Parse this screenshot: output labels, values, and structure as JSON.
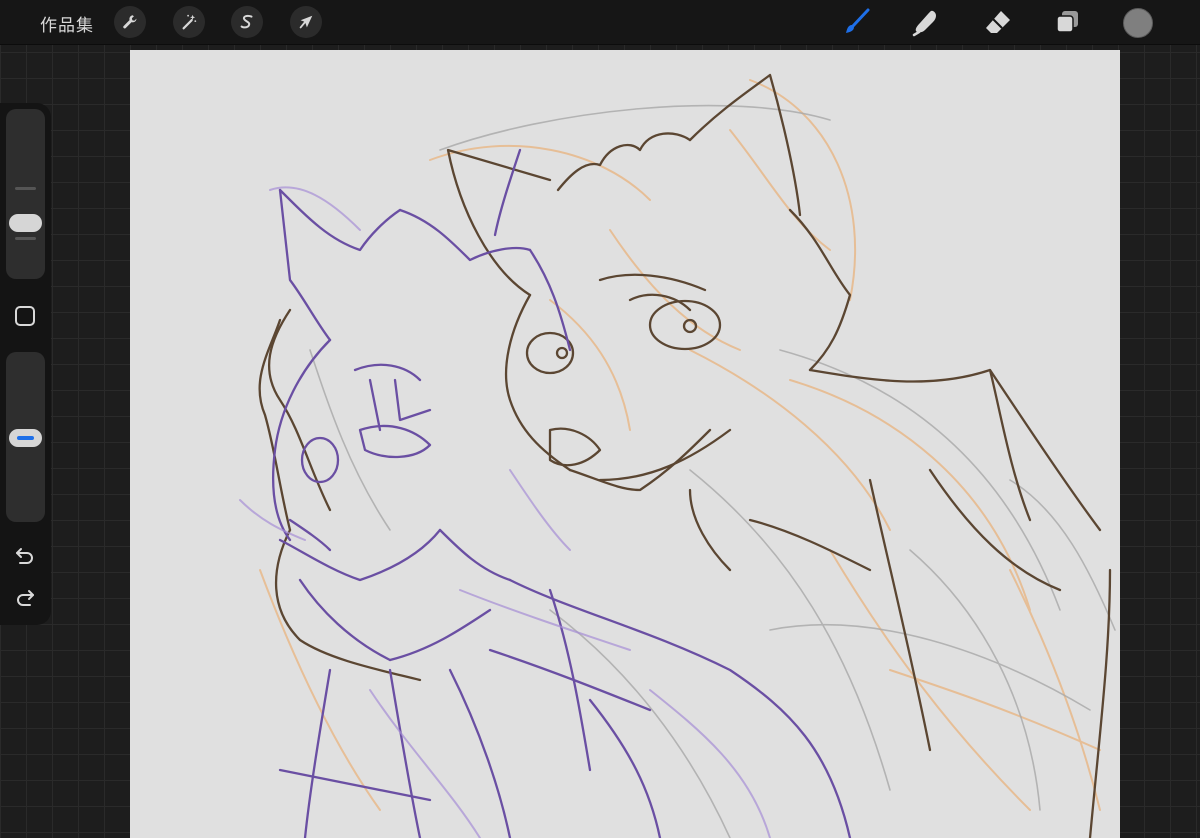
{
  "toolbar": {
    "gallery_label": "作品集",
    "left_tools": [
      {
        "name": "actions",
        "icon": "wrench-icon"
      },
      {
        "name": "adjustments",
        "icon": "magic-wand-icon"
      },
      {
        "name": "selection",
        "icon": "selection-s-icon"
      },
      {
        "name": "transform",
        "icon": "arrow-cursor-icon"
      }
    ],
    "right_tools": [
      {
        "name": "brush",
        "icon": "brush-icon",
        "active": true
      },
      {
        "name": "smudge",
        "icon": "smudge-finger-icon"
      },
      {
        "name": "eraser",
        "icon": "eraser-icon"
      },
      {
        "name": "layers",
        "icon": "layers-icon"
      }
    ],
    "active_color": "#7f7f7f",
    "accent_color": "#1e6fe8"
  },
  "sidebar": {
    "brush_size_level": 0.55,
    "opacity_level": 0.5,
    "modify_button_icon": "square-icon",
    "undo_icon": "undo-icon",
    "redo_icon": "redo-icon"
  },
  "canvas": {
    "background": "#e0e0e0",
    "sketch_colors": {
      "purple": "#6a4fa3",
      "brown": "#5b4632",
      "orange": "#e8b98a"
    }
  }
}
